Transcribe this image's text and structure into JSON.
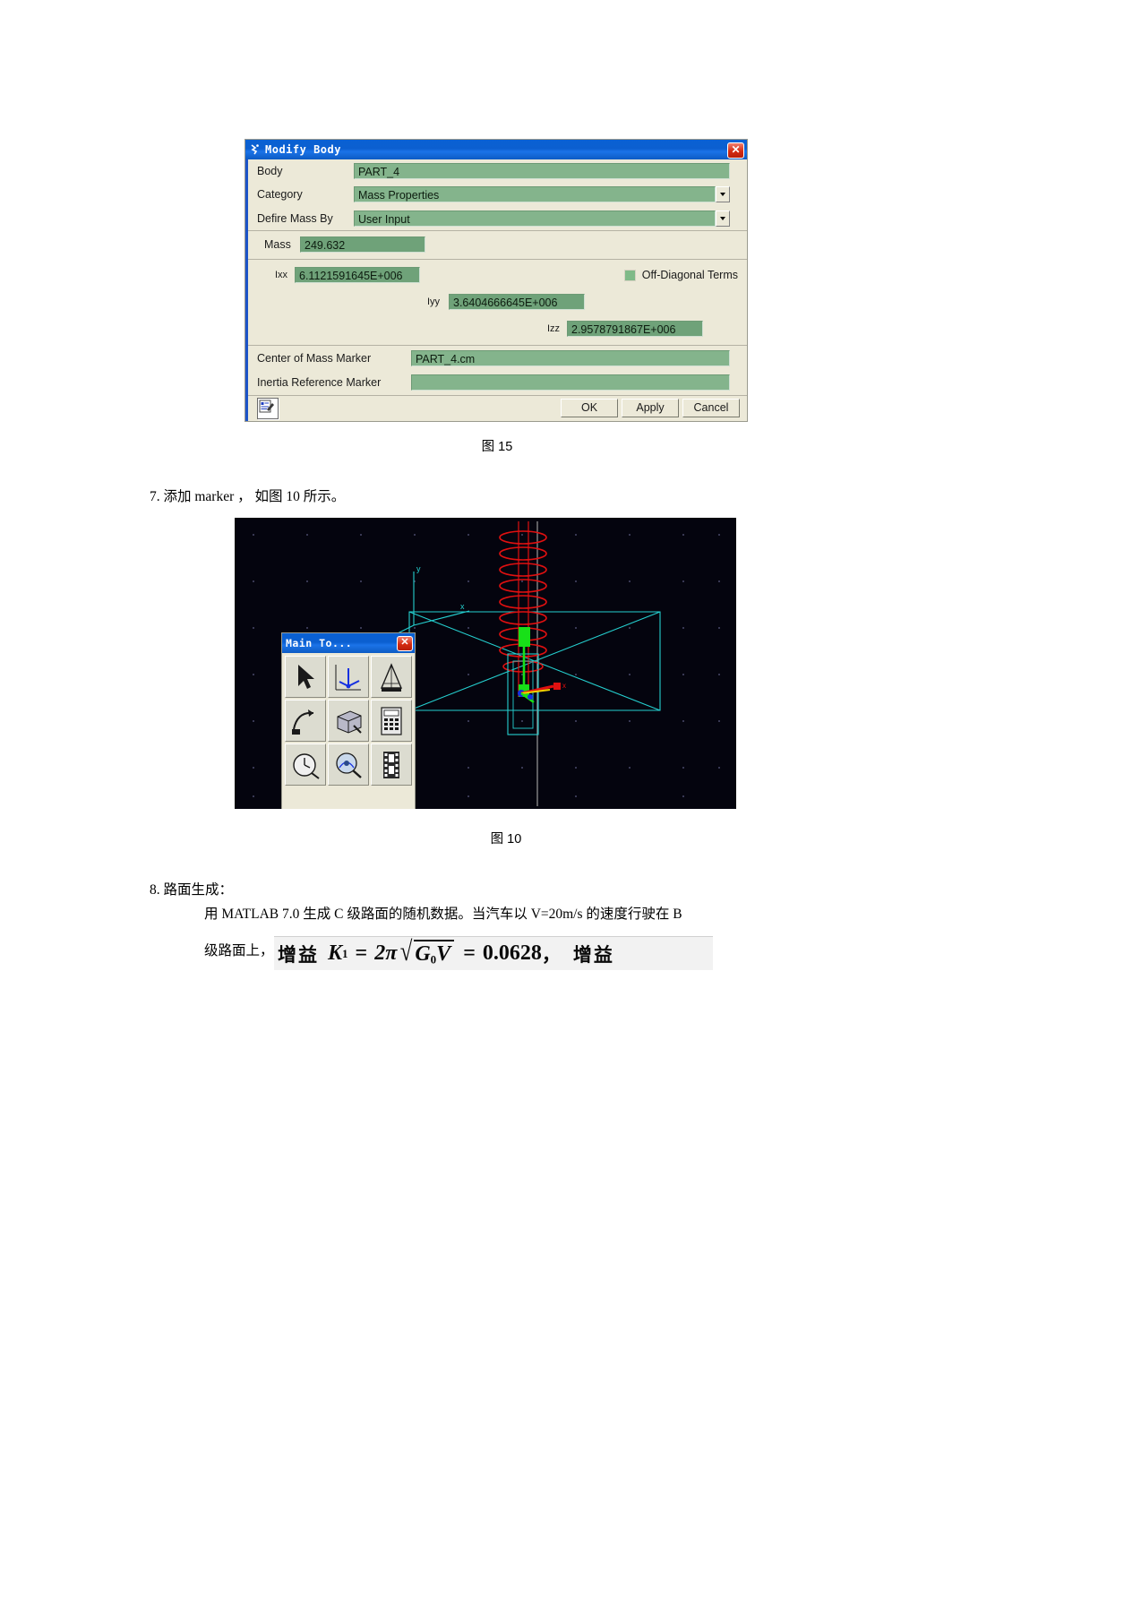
{
  "dialog": {
    "title": "Modify Body",
    "title_icon": "adams-runner-icon",
    "close_label": "✕",
    "fields": {
      "body_label": "Body",
      "body_value": "PART_4",
      "category_label": "Category",
      "category_value": "Mass Properties",
      "define_mass_by_label": "Defire Mass By",
      "define_mass_by_value": "User Input",
      "mass_label": "Mass",
      "mass_value": "249.632",
      "ixx_label": "Ixx",
      "ixx_value": "6.1121591645E+006",
      "iyy_label": "Iyy",
      "iyy_value": "3.6404666645E+006",
      "izz_label": "Izz",
      "izz_value": "2.9578791867E+006",
      "off_diagonal_label": "Off-Diagonal Terms",
      "com_marker_label": "Center of Mass Marker",
      "com_marker_value": "PART_4.cm",
      "inertia_ref_marker_label": "Inertia Reference Marker",
      "inertia_ref_marker_value": ""
    },
    "buttons": {
      "ok": "OK",
      "apply": "Apply",
      "cancel": "Cancel"
    }
  },
  "captions": {
    "fig15": "图 15",
    "fig10": "图 10"
  },
  "steps": {
    "step7": "7.  添加 marker ， 如图   10 所示。",
    "step8": "8.  路面生成：",
    "step8_line1": "用 MATLAB 7.0 生成 C 级路面的随机数据。当汽车以        V=20m/s 的速度行驶在   B",
    "step8_line2_prefix": "级路面上，"
  },
  "formula": {
    "gain_word": "增益",
    "k_symbol": "K",
    "k_sub": "1",
    "equals": "=",
    "two_pi": "2π",
    "radicand_g": "G",
    "radicand_g_sub": "0",
    "radicand_v": "V",
    "result_equals": "=",
    "result": "0.0628",
    "comma": "，",
    "trailing_gain": "增益"
  },
  "viewport": {
    "palette": {
      "title": "Main To...",
      "close_label": "✕",
      "buttons": [
        "select-arrow-tool",
        "marker-axes-tool",
        "measure-tool",
        "motion-arc-tool",
        "rigid-body-box-tool",
        "calculator-tool",
        "clock-simulate-tool",
        "plot-review-tool",
        "animation-film-tool"
      ]
    },
    "axis_labels": {
      "y": "y",
      "x": "x",
      "marker_x": "x"
    }
  },
  "colors": {
    "title_blue": "#0b5fd0",
    "field_green": "#84b48c",
    "dialog_face": "#ece9d8",
    "viewport_bg": "#04040e",
    "spring_red": "#e01010",
    "geometry_cyan": "#25d0d0",
    "marker_green": "#18e018"
  }
}
